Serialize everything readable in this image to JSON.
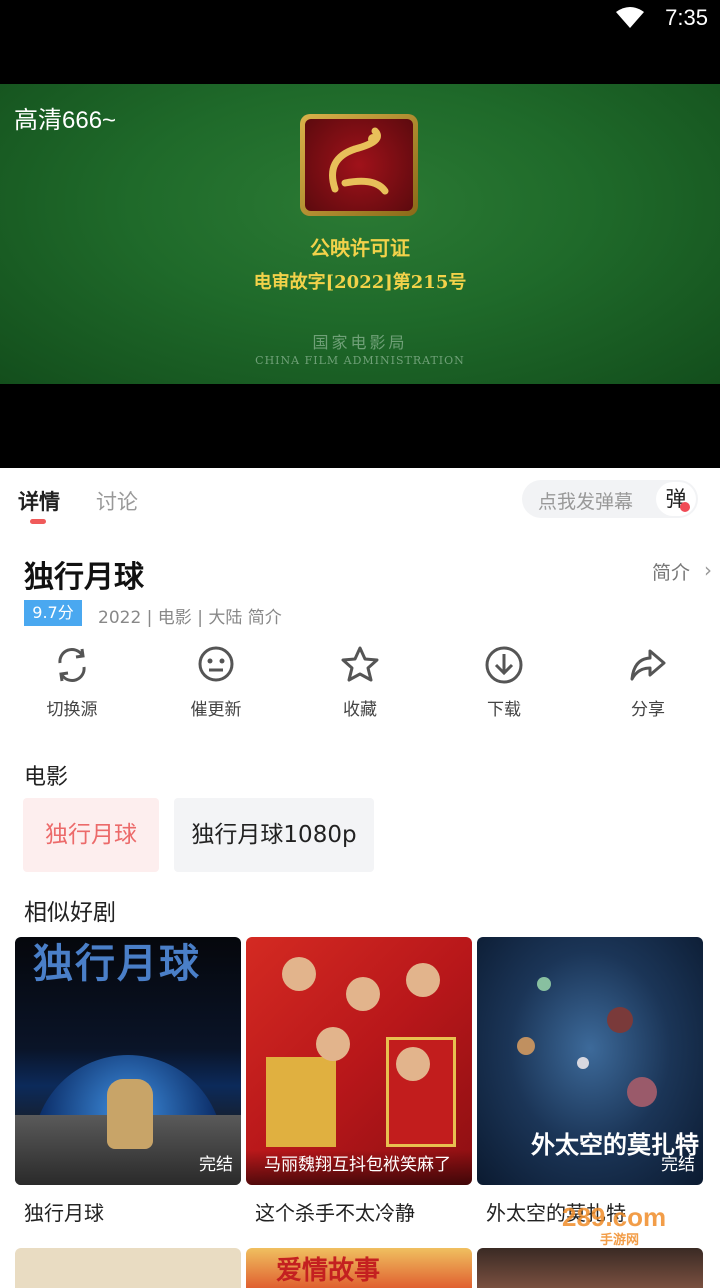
{
  "status_bar": {
    "time": "7:35"
  },
  "player": {
    "quality": "高清666~",
    "license_title": "公映许可证",
    "license_number": "电审故字[2022]第215号",
    "admin_cn": "国家电影局",
    "admin_en": "CHINA FILM ADMINISTRATION"
  },
  "tabs": {
    "details": "详情",
    "discussion": "讨论"
  },
  "danmaku": {
    "placeholder": "点我发弹幕",
    "button": "弹"
  },
  "movie": {
    "title": "独行月球",
    "intro_link": "简介",
    "score": "9.7分",
    "meta": "2022 | 电影 | 大陆 简介"
  },
  "actions": [
    {
      "label": "切换源",
      "icon": "refresh-icon"
    },
    {
      "label": "催更新",
      "icon": "chat-icon"
    },
    {
      "label": "收藏",
      "icon": "star-icon"
    },
    {
      "label": "下载",
      "icon": "download-icon"
    },
    {
      "label": "分享",
      "icon": "share-icon"
    }
  ],
  "sources": {
    "heading": "电影",
    "items": [
      "独行月球",
      "独行月球1080p"
    ]
  },
  "similar": {
    "heading": "相似好剧",
    "items": [
      {
        "name": "独行月球",
        "badge": "完结",
        "caption": "",
        "poster_title": "独行月球"
      },
      {
        "name": "这个杀手不太冷静",
        "badge": "",
        "caption": "马丽魏翔互抖包袱笑麻了",
        "poster_title": ""
      },
      {
        "name": "外太空的莫扎特",
        "badge": "完结",
        "caption": "",
        "poster_title": "外太空的莫扎特"
      }
    ],
    "row2_titles": [
      "",
      "爱情故事",
      ""
    ]
  },
  "watermark": {
    "main": "289.com",
    "sub": "手游网"
  },
  "colors": {
    "accent": "#f05a5a",
    "score_bg": "#4aa8f0"
  }
}
